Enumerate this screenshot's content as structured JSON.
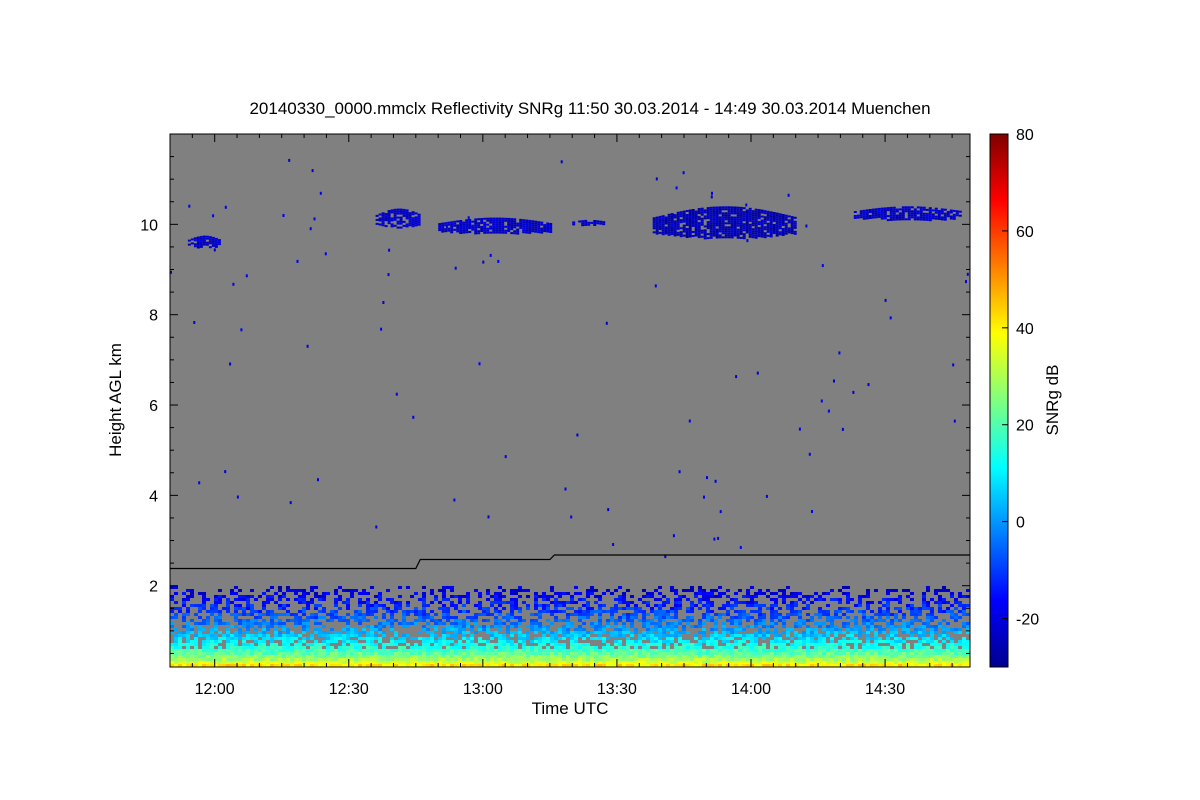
{
  "chart_data": {
    "type": "heatmap",
    "title": "20140330_0000.mmclx Reflectivity SNRg   11:50 30.03.2014 - 14:49 30.03.2014 Muenchen",
    "xlabel": "Time UTC",
    "ylabel": "Height AGL km",
    "colorbar_label": "SNRg dB",
    "background_color": "#808080",
    "x_range": [
      "11:50",
      "14:49"
    ],
    "y_range": [
      0.2,
      12.0
    ],
    "x_ticks": [
      "12:00",
      "12:30",
      "13:00",
      "13:30",
      "14:00",
      "14:30"
    ],
    "y_ticks": [
      2,
      4,
      6,
      8,
      10
    ],
    "colorbar_range": [
      -30,
      80
    ],
    "colorbar_ticks": [
      -20,
      0,
      20,
      40,
      60,
      80
    ],
    "colormap": "jet",
    "boundary_layer_height": [
      {
        "time": "11:50",
        "height": 2.38
      },
      {
        "time": "12:45",
        "height": 2.38
      },
      {
        "time": "12:46",
        "height": 2.58
      },
      {
        "time": "13:15",
        "height": 2.58
      },
      {
        "time": "13:16",
        "height": 2.68
      },
      {
        "time": "14:49",
        "height": 2.68
      }
    ],
    "cloud_layers": [
      {
        "start": "11:54",
        "end": "12:01",
        "base": 9.5,
        "top": 9.75,
        "snr": -22
      },
      {
        "start": "12:36",
        "end": "12:46",
        "base": 9.95,
        "top": 10.35,
        "snr": -22
      },
      {
        "start": "12:50",
        "end": "13:15",
        "base": 9.8,
        "top": 10.15,
        "snr": -22
      },
      {
        "start": "13:20",
        "end": "13:27",
        "base": 10.0,
        "top": 10.1,
        "snr": -23
      },
      {
        "start": "13:38",
        "end": "14:10",
        "base": 9.7,
        "top": 10.4,
        "snr": -24
      },
      {
        "start": "14:23",
        "end": "14:47",
        "base": 10.1,
        "top": 10.4,
        "snr": -22
      }
    ],
    "near_surface_echo": {
      "start": "11:50",
      "end": "14:49",
      "top_height": 2.0,
      "snr_at_surface": 60,
      "snr_at_top": -22
    }
  }
}
